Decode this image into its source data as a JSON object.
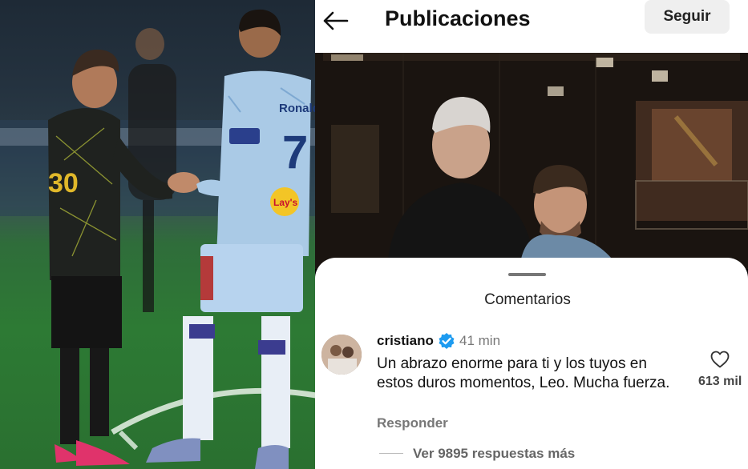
{
  "header": {
    "title": "Publicaciones",
    "follow_label": "Seguir",
    "back_icon": "back-arrow-icon"
  },
  "comments": {
    "sheet_title": "Comentarios",
    "items": [
      {
        "username": "cristiano",
        "verified": true,
        "time": "41 min",
        "text": "Un abrazo enorme para ti y los tuyos en estos duros momentos, Leo. Mucha fuerza.",
        "reply_label": "Responder",
        "likes": "613 mil"
      }
    ],
    "view_replies_label": "Ver 9895 respuestas más"
  },
  "left_photo": {
    "jersey_left_number": "30",
    "jersey_right_name": "Ronaldo",
    "jersey_right_number": "7",
    "sponsor": "Lay's"
  },
  "colors": {
    "verified": "#1d9bf0",
    "header_bg": "#ffffff",
    "follow_bg": "#efefef"
  }
}
